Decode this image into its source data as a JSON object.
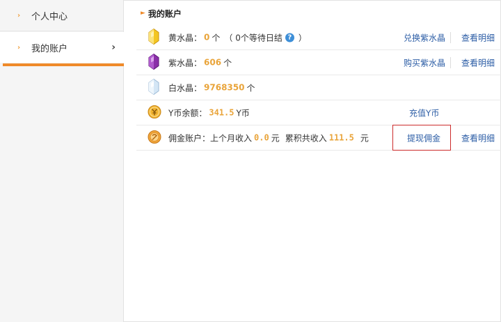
{
  "sidebar": {
    "items": [
      {
        "label": "个人中心"
      },
      {
        "label": "我的账户"
      }
    ],
    "arrow": "›",
    "chevron": "›"
  },
  "main": {
    "title": "我的账户",
    "rows": [
      {
        "icon": "yellow-crystal-icon",
        "label": "黄水晶：",
        "value": "0",
        "unit": "个",
        "note_prefix": "（ 0个等待日结",
        "note_suffix": "）",
        "actions": [
          "兑换紫水晶",
          "查看明细"
        ]
      },
      {
        "icon": "purple-crystal-icon",
        "label": "紫水晶：",
        "value": "606",
        "unit": "个",
        "actions": [
          "购买紫水晶",
          "查看明细"
        ]
      },
      {
        "icon": "white-crystal-icon",
        "label": "白水晶：",
        "value": "9768350",
        "unit": "个",
        "actions": []
      },
      {
        "icon": "y-coin-icon",
        "label": "Y币余额：",
        "value": "341.5",
        "unit": "Y币",
        "actions": [
          "充值Y币"
        ]
      },
      {
        "icon": "commission-coin-icon",
        "label": "佣金账户：上个月收入",
        "value": "0.0",
        "unit": "元",
        "label2": "累积共收入",
        "value2": "111.5",
        "unit2": "元",
        "actions": [
          "提现佣金",
          "查看明细"
        ]
      }
    ]
  },
  "help_glyph": "?",
  "colors": {
    "accent_orange": "#ef8a29",
    "value_gold": "#e9a43a",
    "link_blue": "#2d5ea6",
    "highlight_red": "#cc2b2b"
  }
}
